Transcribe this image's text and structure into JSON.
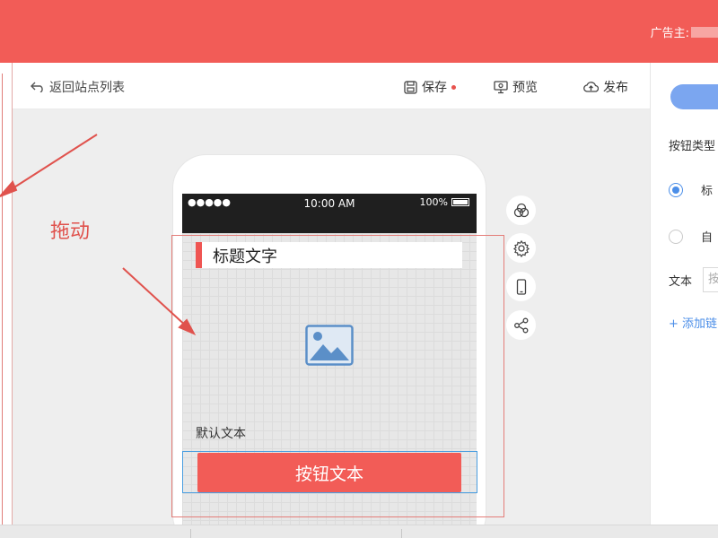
{
  "header": {
    "advertiser_label": "广告主:",
    "brand_color": "#f25c57"
  },
  "toolbar": {
    "back_label": "返回站点列表",
    "save_label": "保存",
    "preview_label": "预览",
    "publish_label": "发布"
  },
  "phone": {
    "status_signal": "●●●●●",
    "status_time": "10:00 AM",
    "status_battery": "100%",
    "title_text": "标题文字",
    "default_text": "默认文本",
    "button_text": "按钮文本"
  },
  "side_tools": [
    "layers-icon",
    "gear-icon",
    "mobile-icon",
    "share-icon"
  ],
  "annotation": {
    "drag_label": "拖动"
  },
  "right_panel": {
    "button_type_label": "按钮类型",
    "radio_options": [
      {
        "label": "标",
        "checked": true
      },
      {
        "label": "自",
        "checked": false
      }
    ],
    "text_label": "文本",
    "text_input_value": "按",
    "add_link_label": "+ 添加链",
    "accent_color": "#4b8ee8"
  }
}
